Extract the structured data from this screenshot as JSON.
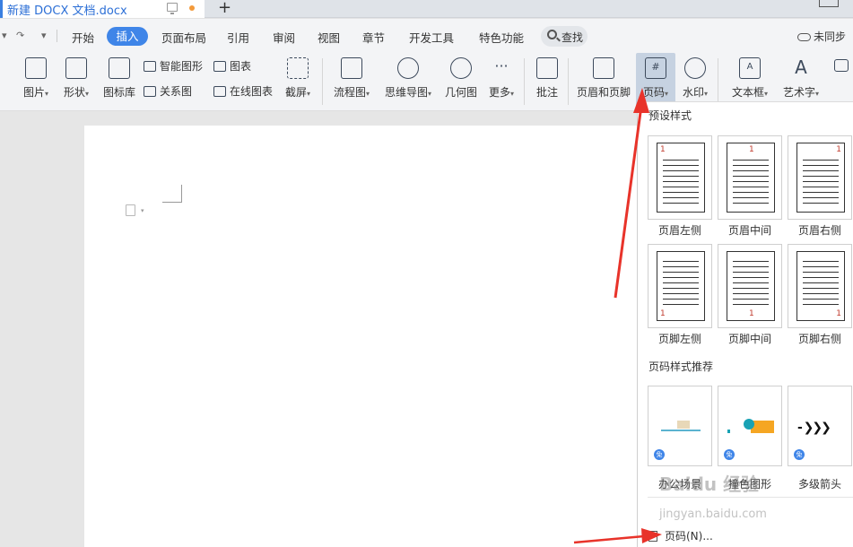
{
  "tab": {
    "title": "新建 DOCX 文档.docx",
    "new_tab": "+"
  },
  "quick_access": {
    "undo": "↶",
    "redo": "↷",
    "more": "▾"
  },
  "menu": {
    "items": [
      "开始",
      "插入",
      "页面布局",
      "引用",
      "审阅",
      "视图",
      "章节",
      "开发工具",
      "特色功能"
    ],
    "active": "插入",
    "search_label": "查找",
    "sync_label": "未同步"
  },
  "ribbon": {
    "picture": "图片",
    "shape": "形状",
    "icon_lib": "图标库",
    "smart_art": "智能图形",
    "chart": "图表",
    "relation": "关系图",
    "online_chart": "在线图表",
    "screenshot": "截屏",
    "flowchart": "流程图",
    "mindmap": "思维导图",
    "geometry": "几何图",
    "more": "更多",
    "comment": "批注",
    "header_footer": "页眉和页脚",
    "page_number": "页码",
    "watermark": "水印",
    "textbox": "文本框",
    "wordart": "艺术字"
  },
  "dropdown": {
    "preset_title": "预设样式",
    "presets": [
      {
        "label": "页眉左侧",
        "num": "1"
      },
      {
        "label": "页眉中间",
        "num": "1"
      },
      {
        "label": "页眉右侧",
        "num": "1"
      },
      {
        "label": "页脚左侧",
        "num": "1"
      },
      {
        "label": "页脚中间",
        "num": "1"
      },
      {
        "label": "页脚右侧",
        "num": "1"
      }
    ],
    "recommend_title": "页码样式推荐",
    "recommend": [
      {
        "label": "办公场景",
        "badge": "免"
      },
      {
        "label": "撞色图形",
        "badge": "免"
      },
      {
        "label": "多级箭头",
        "badge": "免"
      }
    ],
    "page_number_item": "页码(N)..."
  },
  "watermark_text": {
    "brand": "Baidu 经验",
    "url": "jingyan.baidu.com"
  },
  "colors": {
    "accent": "#3f85e8",
    "arrow": "#e8332a",
    "orange": "#f5a623",
    "teal": "#19a2b4"
  }
}
